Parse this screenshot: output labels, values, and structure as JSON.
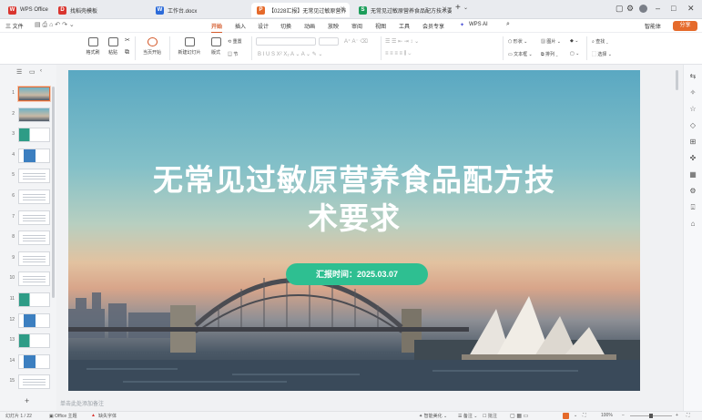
{
  "tabs": [
    {
      "label": "WPS Office",
      "icon": "wps-logo-icon",
      "color": "#d9352f"
    },
    {
      "label": "找稻壳模板",
      "icon": "docer-icon",
      "color": "#d9352f"
    },
    {
      "label": "工作台.docx",
      "icon": "word-doc-icon",
      "color": "#2c6bd9"
    },
    {
      "label": "【0228汇报】无常见过敏原营养",
      "icon": "ppt-icon",
      "color": "#e56a2b"
    },
    {
      "label": "无常见过敏原营养食品配方技术要求",
      "icon": "sheet-icon",
      "color": "#1d9e5b"
    }
  ],
  "menu": {
    "file": "三 文件",
    "items": [
      "开始",
      "插入",
      "设计",
      "切换",
      "动画",
      "放映",
      "审阅",
      "视图",
      "工具",
      "会员专享"
    ],
    "active": "开始",
    "ai": "WPS AI",
    "right_btn1": "智能体",
    "share": "分享"
  },
  "ribbon": {
    "format_painter": "格式刷",
    "paste": "粘贴",
    "from_current": "当页开始",
    "new_slide": "新建幻灯片",
    "layout": "版式",
    "reset": "重置",
    "section": "节",
    "shape": "形状",
    "picture": "图片",
    "textbox": "文本框",
    "arrange": "排列",
    "find": "查找",
    "select": "选择"
  },
  "slide": {
    "title": "无常见过敏原营养食品配方技术要求",
    "report_time": "汇报时间：2025.03.07"
  },
  "thumbnails": [
    "1",
    "2",
    "3",
    "4",
    "5",
    "6",
    "7",
    "8",
    "9",
    "10",
    "11",
    "12",
    "13",
    "14",
    "15"
  ],
  "notes_placeholder": "单击此处添加备注",
  "status": {
    "slide_count": "幻灯片 1 / 22",
    "theme": "Office 主题",
    "missing_font": "缺失字体",
    "smart_beautify": "智能美化",
    "notes": "备注",
    "comment": "批注",
    "zoom": "100%"
  },
  "colors": {
    "accent": "#d45a2b",
    "pill": "#2ebf91"
  }
}
